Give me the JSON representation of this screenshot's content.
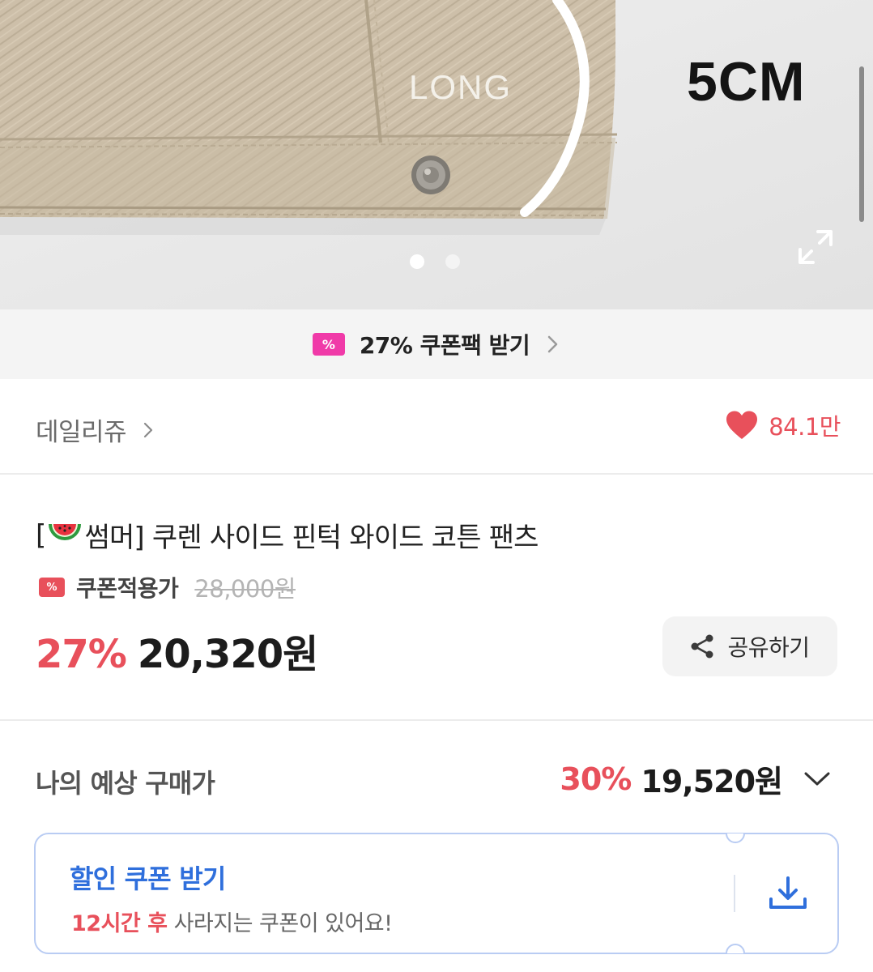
{
  "hero": {
    "overlay_long": "LONG",
    "overlay_size": "5CM",
    "page_indicator": {
      "total": 2,
      "active": 1
    },
    "expand_icon": "expand-icon"
  },
  "coupon_pack": {
    "icon": "coupon-ticket-icon",
    "ticket_glyph": "%",
    "label": "27% 쿠폰팩 받기",
    "chevron": "chevron-right-icon"
  },
  "brand": {
    "name": "데일리쥬",
    "chevron": "chevron-right-icon",
    "like_icon": "heart-icon",
    "like_count": "84.1만"
  },
  "product": {
    "title_prefix": "[",
    "title_emoji": "watermelon-icon",
    "title_rest": "썸머] 쿠렌 사이드 핀턱 와이드 코튼 팬츠",
    "coupon_label": "쿠폰적용가",
    "original_price": "28,000원",
    "discount_rate": "27%",
    "sale_price": "20,320원",
    "share_label": "공유하기"
  },
  "expected_price": {
    "label": "나의 예상 구매가",
    "discount_rate": "30%",
    "price": "19,520원"
  },
  "discount_coupon": {
    "title": "할인 쿠폰 받기",
    "sub_highlight": "12시간 후",
    "sub_rest": " 사라지는 쿠폰이 있어요!",
    "download_icon": "download-icon"
  },
  "colors": {
    "accent_red": "#e8505b",
    "coupon_pink": "#f03aa8",
    "link_blue": "#2f6fdc",
    "coupon_border": "#b9ccf3"
  }
}
